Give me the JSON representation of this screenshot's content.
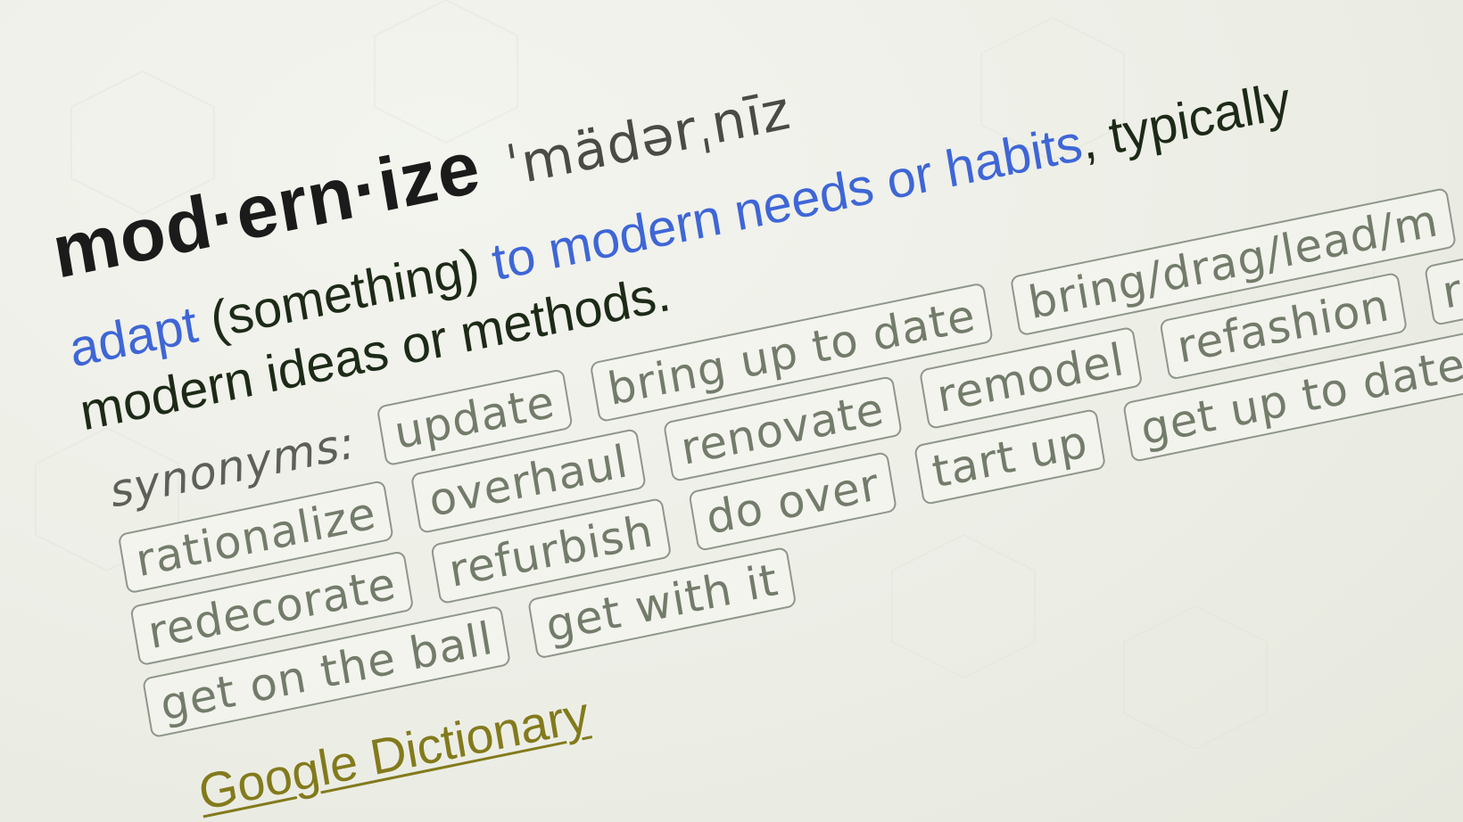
{
  "entry": {
    "headword": "mod·ern·ize",
    "pronunciation": "ˈmädərˌnīz"
  },
  "definition": {
    "line1_link1": "adapt",
    "line1_text1": " (something) ",
    "line1_link2": "to modern needs or habits",
    "line1_text2": ", typically",
    "line2": "modern ideas or methods."
  },
  "synonyms": {
    "label": "synonyms:",
    "row1": [
      "update",
      "bring up to date",
      "bring/drag/lead/m"
    ],
    "row2": [
      "rationalize",
      "overhaul",
      "renovate",
      "remodel",
      "refashion",
      "re"
    ],
    "row3": [
      "redecorate",
      "refurbish",
      "do over",
      "tart up",
      "get up to date"
    ],
    "row4": [
      "get on the ball",
      "get with it"
    ]
  },
  "source": {
    "label": "Google Dictionary"
  },
  "colors": {
    "link_blue": "#3f66d6",
    "source_gold": "#837a1c",
    "chip_text": "#737c6b"
  }
}
